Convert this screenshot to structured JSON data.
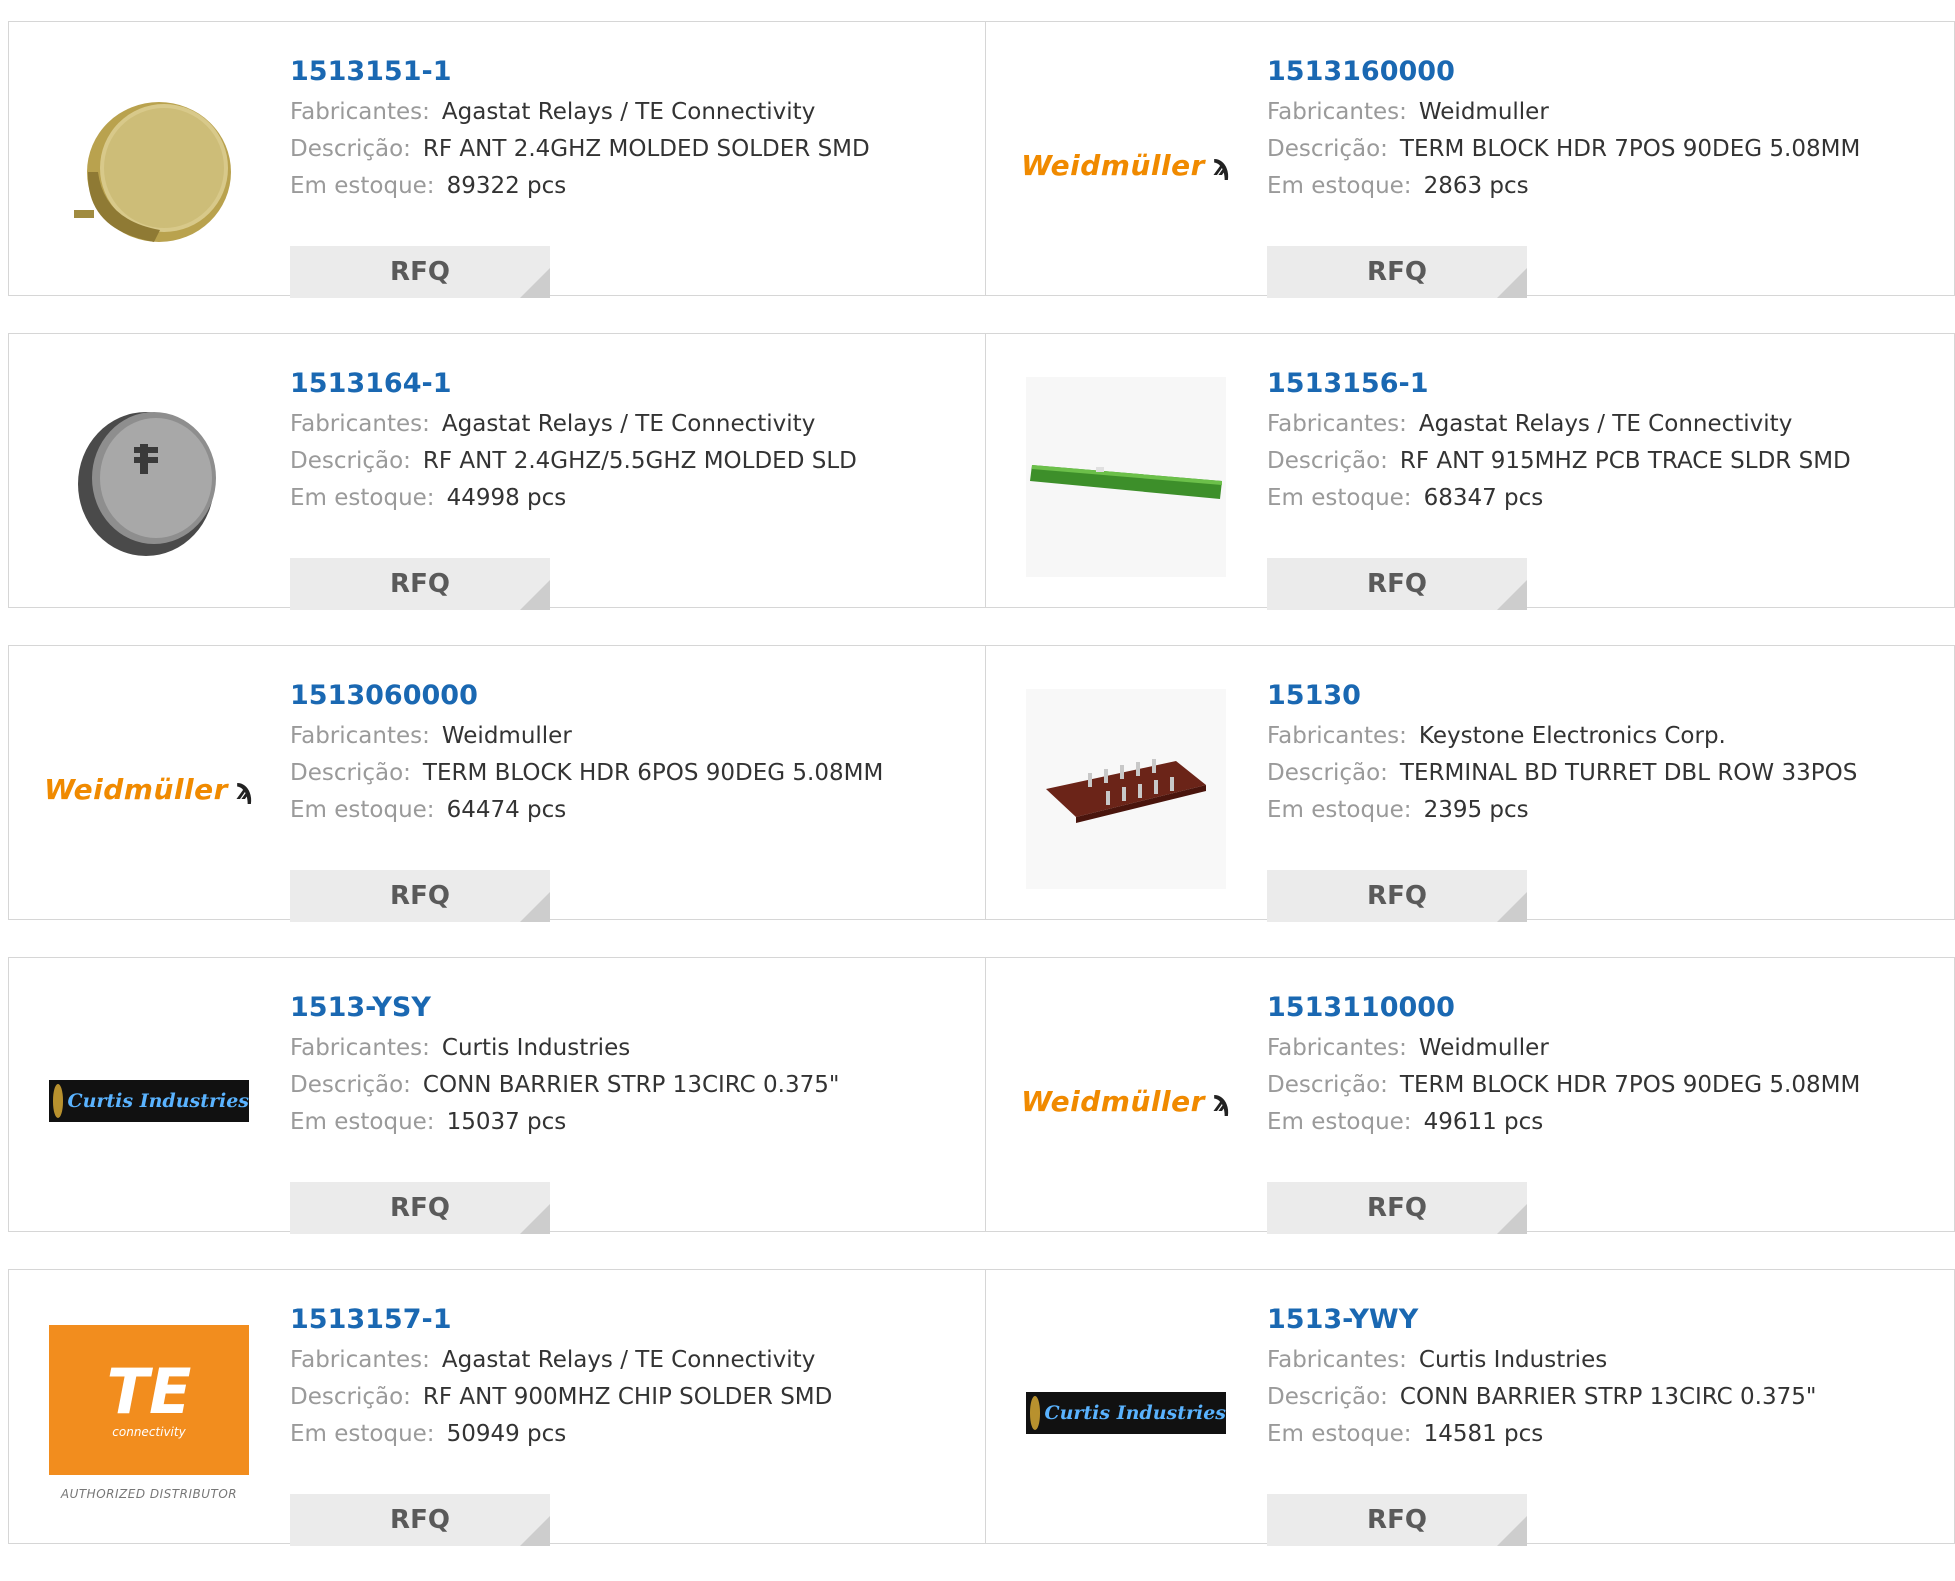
{
  "labels": {
    "manufacturer": "Fabricantes:",
    "description": "Descrição:",
    "stock": "Em estoque:",
    "rfq": "RFQ"
  },
  "logos": {
    "weidmuller": "Weidmüller",
    "curtis": "Curtis Industries",
    "te_main": "TE",
    "te_sub": "connectivity",
    "te_authorized": "AUTHORIZED DISTRIBUTOR"
  },
  "colors": {
    "part_link": "#1a68b2",
    "weidmuller_orange": "#f08a00",
    "te_orange": "#f28d1e"
  },
  "products": [
    {
      "part": "1513151-1",
      "manufacturer": "Agastat Relays / TE Connectivity",
      "description": "RF ANT 2.4GHZ MOLDED SOLDER SMD",
      "stock": "89322 pcs",
      "image": "molded-antenna-gold"
    },
    {
      "part": "1513160000",
      "manufacturer": "Weidmuller",
      "description": "TERM BLOCK HDR 7POS 90DEG 5.08MM",
      "stock": "2863 pcs",
      "image": "weidmuller-logo"
    },
    {
      "part": "1513164-1",
      "manufacturer": "Agastat Relays / TE Connectivity",
      "description": "RF ANT 2.4GHZ/5.5GHZ MOLDED SLD",
      "stock": "44998 pcs",
      "image": "molded-antenna-gray"
    },
    {
      "part": "1513156-1",
      "manufacturer": "Agastat Relays / TE Connectivity",
      "description": "RF ANT 915MHZ PCB TRACE SLDR SMD",
      "stock": "68347 pcs",
      "image": "pcb-trace-antenna"
    },
    {
      "part": "1513060000",
      "manufacturer": "Weidmuller",
      "description": "TERM BLOCK HDR 6POS 90DEG 5.08MM",
      "stock": "64474 pcs",
      "image": "weidmuller-logo"
    },
    {
      "part": "15130",
      "manufacturer": "Keystone Electronics Corp.",
      "description": "TERMINAL BD TURRET DBL ROW 33POS",
      "stock": "2395 pcs",
      "image": "turret-board"
    },
    {
      "part": "1513-YSY",
      "manufacturer": "Curtis Industries",
      "description": "CONN BARRIER STRP 13CIRC 0.375\"",
      "stock": "15037 pcs",
      "image": "curtis-logo"
    },
    {
      "part": "1513110000",
      "manufacturer": "Weidmuller",
      "description": "TERM BLOCK HDR 7POS 90DEG 5.08MM",
      "stock": "49611 pcs",
      "image": "weidmuller-logo"
    },
    {
      "part": "1513157-1",
      "manufacturer": "Agastat Relays / TE Connectivity",
      "description": "RF ANT 900MHZ CHIP SOLDER SMD",
      "stock": "50949 pcs",
      "image": "te-logo"
    },
    {
      "part": "1513-YWY",
      "manufacturer": "Curtis Industries",
      "description": "CONN BARRIER STRP 13CIRC 0.375\"",
      "stock": "14581 pcs",
      "image": "curtis-logo"
    }
  ]
}
